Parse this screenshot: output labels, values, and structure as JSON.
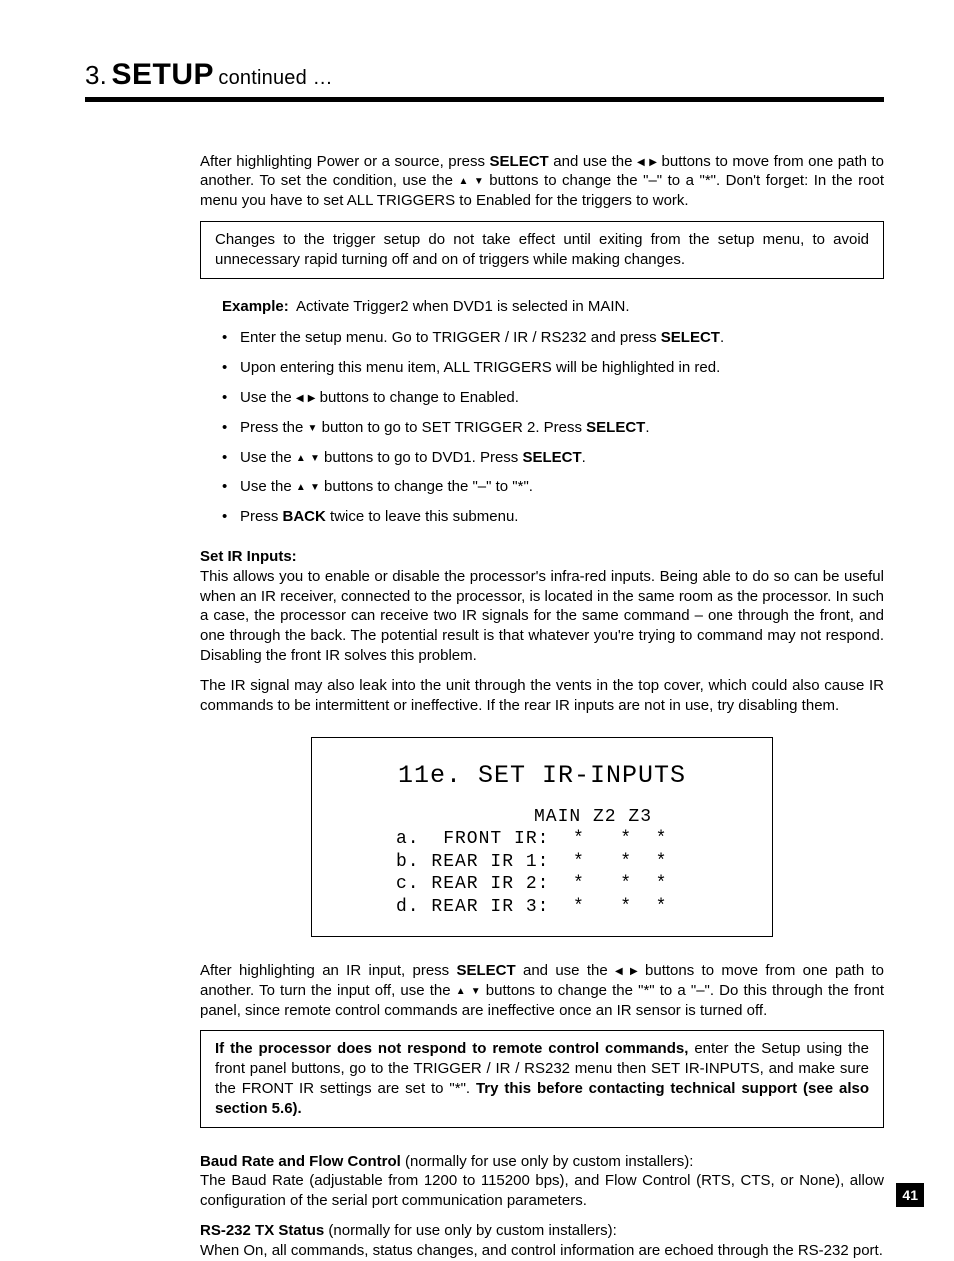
{
  "header": {
    "section_number": "3.",
    "section_title": "SETUP",
    "continued": "continued …"
  },
  "intro": "After highlighting Power or a source, press SELECT and use the ◂ ▸ buttons to move from one path to another. To set the condition, use the ▴ ▾ buttons to change the \"–\" to a \"*\". Don't forget: In the root menu you have to set ALL TRIGGERS to Enabled for the triggers to work.",
  "note_box": "Changes to the trigger setup do not take effect until exiting from the setup menu, to avoid unnecessary rapid turning off and on of triggers while making changes.",
  "example": {
    "label": "Example:",
    "text": "Activate Trigger2 when DVD1 is selected in MAIN.",
    "steps": [
      "Enter the setup menu. Go to TRIGGER / IR / RS232 and press SELECT.",
      "Upon entering this menu item, ALL TRIGGERS will be highlighted in red.",
      "Use the ◂ ▸ buttons to change to Enabled.",
      "Press the ▾ button to go to SET TRIGGER 2. Press SELECT.",
      "Use the ▴ ▾ buttons to go to DVD1. Press SELECT.",
      "Use the ▴ ▾ buttons to change the \"–\" to \"*\".",
      "Press BACK twice to leave this submenu."
    ]
  },
  "set_ir": {
    "heading": "Set IR Inputs:",
    "p1": "This allows you to enable or disable the processor's infra-red inputs. Being able to do so can be useful when an IR receiver, connected to the processor, is located in the same room as the processor. In such a case, the processor can receive two IR signals for the same command – one through the front, and one through the back. The potential result is that whatever you're trying to command may not respond. Disabling the front IR solves this problem.",
    "p2": "The IR signal may also leak into the unit through the vents in the top cover, which could also cause IR commands to be intermittent or ineffective. If the rear IR inputs are not in use, try disabling them."
  },
  "osd": {
    "title": "11e. SET IR-INPUTS",
    "columns": "MAIN Z2 Z3",
    "rows": [
      "a.  FRONT IR:  *   *  *",
      "b. REAR IR 1:  *   *  *",
      "c. REAR IR 2:  *   *  *",
      "d. REAR IR 3:  *   *  *"
    ]
  },
  "after_osd": "After highlighting an IR input, press SELECT and use the ◂ ▸ buttons to move from one path to another. To turn the input off, use the ▴ ▾ buttons to change the \"*\" to a \"–\". Do this through the front panel, since remote control commands are ineffective once an IR sensor is turned off.",
  "warning_box": "If the processor does not respond to remote control commands, enter the Setup using the front panel buttons, go to the TRIGGER / IR / RS232 menu then SET IR-INPUTS, and make sure the FRONT IR settings are set to \"*\". Try this before contacting technical support (see also section 5.6).",
  "baud": {
    "heading": "Baud Rate and Flow Control",
    "note": " (normally for use only by custom installers):",
    "body": "The Baud Rate (adjustable from 1200 to 115200 bps), and Flow Control (RTS, CTS, or None), allow configuration of the serial port communication parameters."
  },
  "rs232": {
    "heading": "RS-232 TX Status",
    "note": " (normally for use only by custom installers):",
    "body": "When On, all commands, status changes, and control information are echoed through the RS-232 port."
  },
  "page_number": "41"
}
